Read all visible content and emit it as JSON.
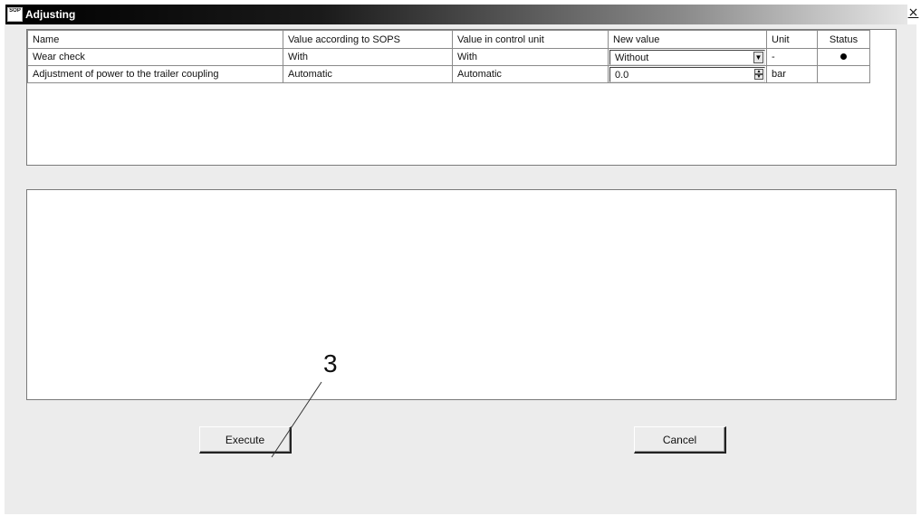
{
  "window": {
    "title": "Adjusting",
    "icon_label": "SOP",
    "close_symbol": "×"
  },
  "table": {
    "columns": [
      "Name",
      "Value according to SOPS",
      "Value in control unit",
      "New value",
      "Unit",
      "Status"
    ],
    "rows": [
      {
        "name": "Wear check",
        "value_sops": "With",
        "value_control_unit": "With",
        "new_value": "Without",
        "new_value_control": "dropdown",
        "unit": "-",
        "status": "dot"
      },
      {
        "name": "Adjustment of power to the trailer coupling",
        "value_sops": "Automatic",
        "value_control_unit": "Automatic",
        "new_value": "0.0",
        "new_value_control": "spinner",
        "unit": "bar",
        "status": ""
      }
    ]
  },
  "buttons": {
    "execute_label": "Execute",
    "cancel_label": "Cancel"
  },
  "callout": {
    "number": "3"
  },
  "icons": {
    "dropdown_arrow": "▼",
    "spin_up": "▲",
    "spin_down": "▼"
  }
}
